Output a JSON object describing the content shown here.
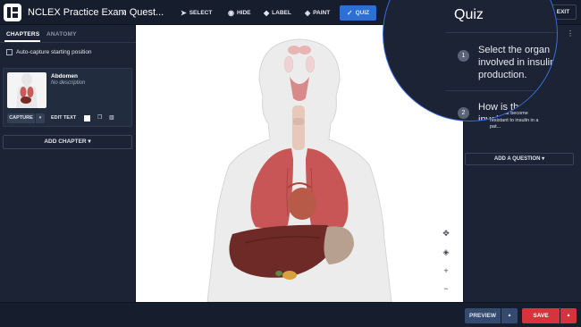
{
  "header": {
    "app_title": "NCLEX Practice Exam Quest...",
    "back_icon": "chevron-left-icon",
    "tools": [
      {
        "label": "SELECT",
        "icon": "cursor-icon"
      },
      {
        "label": "HIDE",
        "icon": "eye-off-icon"
      },
      {
        "label": "LABEL",
        "icon": "tag-icon"
      },
      {
        "label": "PAINT",
        "icon": "paint-bucket-icon"
      },
      {
        "label": "QUIZ",
        "icon": "check-icon",
        "active": true
      }
    ],
    "exit_label": "EXIT",
    "accent_color": "#2d6fd4"
  },
  "left_panel": {
    "tabs": [
      {
        "label": "CHAPTERS",
        "active": true
      },
      {
        "label": "ANATOMY",
        "active": false
      }
    ],
    "auto_capture_label": "Auto-capture starting position",
    "chapter": {
      "name": "Abdomen",
      "description": "No description",
      "capture_label": "CAPTURE",
      "edit_text_label": "EDIT TEXT"
    },
    "add_chapter_label": "ADD CHAPTER ▾"
  },
  "viewport": {
    "nav_icons": [
      "move-icon",
      "rotate-icon",
      "zoom-in-icon",
      "zoom-out-icon"
    ]
  },
  "quiz": {
    "title": "Quiz",
    "questions": [
      {
        "number": "1",
        "text": "Select the organ involved in insulin production."
      },
      {
        "number": "2",
        "text": "How is the pa involved i"
      }
    ],
    "q2_preview": "cells that become resistant to insulin in a pat...",
    "add_question_label": "ADD A QUESTION ▾"
  },
  "footer": {
    "preview_label": "PREVIEW",
    "save_label": "SAVE",
    "save_color": "#d6333c"
  }
}
